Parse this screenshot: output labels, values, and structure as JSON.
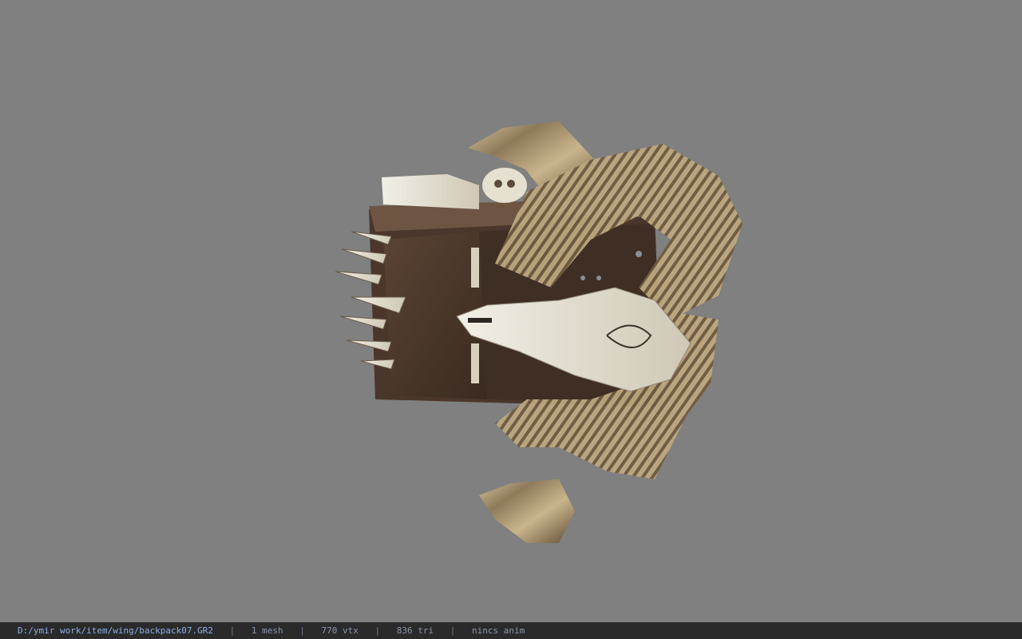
{
  "status_bar": {
    "file_path": "D:/ymir work/item/wing/backpack07.GR2",
    "separator": "|",
    "mesh_count": "1 mesh",
    "vertex_count": "770 vtx",
    "triangle_count": "836 tri",
    "animation": "nincs anim"
  },
  "colors": {
    "viewport_background": "#808080",
    "status_bar_background": "#2a2a2a",
    "status_text": "#8fa0c8"
  }
}
